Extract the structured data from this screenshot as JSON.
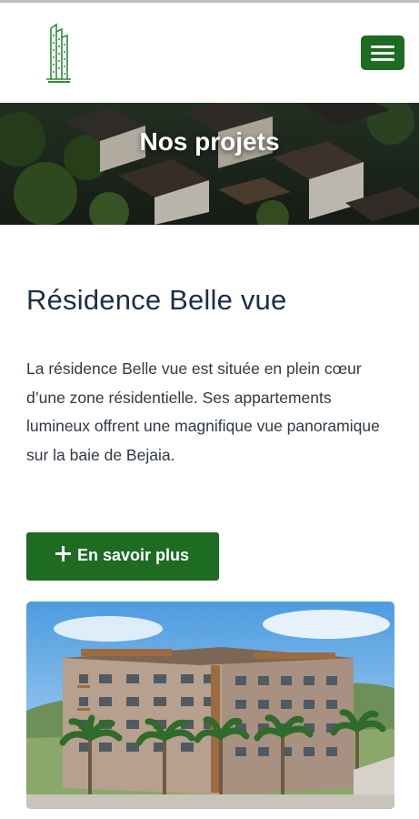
{
  "navbar": {
    "logo_icon": "building-logo-icon",
    "menu_icon": "hamburger-menu-icon",
    "brand_color": "#1e6b22"
  },
  "hero": {
    "title": "Nos projets"
  },
  "project": {
    "title": "Résidence Belle vue",
    "description": "La résidence Belle vue est située en plein cœur d’une zone résidentielle. Ses appartements lumineux offrent une magnifique vue panoramique sur la baie de Bejaia.",
    "cta_icon": "plus-icon",
    "cta_label": "En savoir plus"
  },
  "colors": {
    "accent": "#1e6b22",
    "title": "#1b2f4a",
    "text": "#2f3a45"
  }
}
